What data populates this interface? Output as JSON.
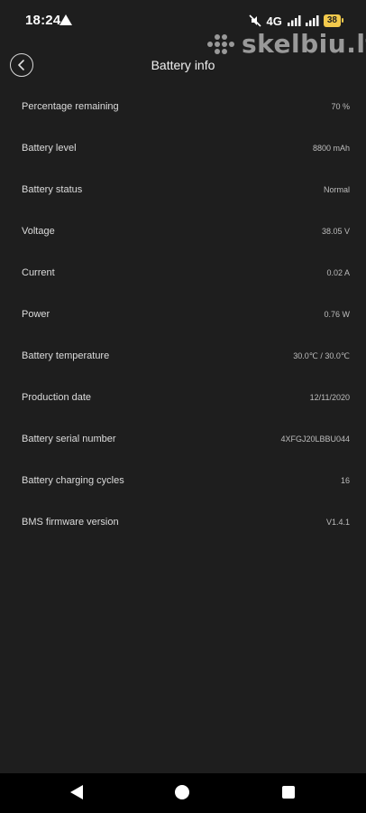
{
  "status_bar": {
    "time": "18:24",
    "network": "4G",
    "battery": "38"
  },
  "watermark": {
    "text": "skelbiu.lt"
  },
  "header": {
    "title": "Battery info"
  },
  "rows": [
    {
      "label": "Percentage remaining",
      "value": "70 %"
    },
    {
      "label": "Battery level",
      "value": "8800 mAh"
    },
    {
      "label": "Battery status",
      "value": "Normal"
    },
    {
      "label": "Voltage",
      "value": "38.05 V"
    },
    {
      "label": "Current",
      "value": "0.02 A"
    },
    {
      "label": "Power",
      "value": "0.76 W"
    },
    {
      "label": "Battery temperature",
      "value": "30.0℃ / 30.0℃"
    },
    {
      "label": "Production date",
      "value": "12/11/2020"
    },
    {
      "label": "Battery serial number",
      "value": "4XFGJ20LBBU044"
    },
    {
      "label": "Battery charging cycles",
      "value": "16"
    },
    {
      "label": "BMS firmware version",
      "value": "V1.4.1"
    }
  ],
  "colors": {
    "background": "#1e1e1e",
    "battery_badge": "#f2c94c",
    "nav_bar": "#000000"
  }
}
